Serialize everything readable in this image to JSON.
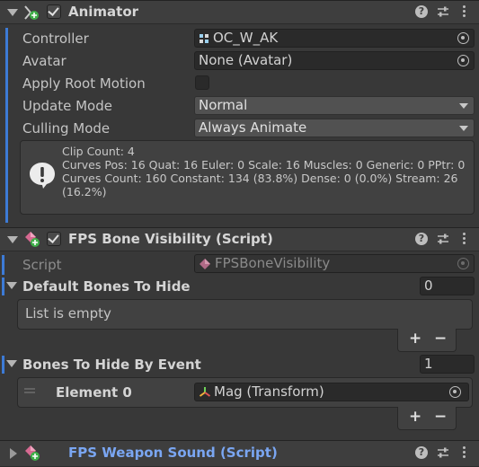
{
  "animator": {
    "title": "Animator",
    "enabled": true,
    "help": "?",
    "props": {
      "controller": {
        "label": "Controller",
        "value": "OC_W_AK"
      },
      "avatar": {
        "label": "Avatar",
        "value": "None (Avatar)"
      },
      "apply_root_motion": {
        "label": "Apply Root Motion",
        "checked": false
      },
      "update_mode": {
        "label": "Update Mode",
        "value": "Normal"
      },
      "culling_mode": {
        "label": "Culling Mode",
        "value": "Always Animate"
      }
    },
    "info": {
      "lines": [
        "Clip Count: 4",
        "Curves Pos: 16 Quat: 16 Euler: 0 Scale: 16 Muscles: 0 Generic: 0 PPtr: 0",
        "Curves Count: 160 Constant: 134 (83.8%) Dense: 0 (0.0%) Stream: 26",
        "(16.2%)"
      ]
    }
  },
  "fps_bone_visibility": {
    "title": "FPS Bone Visibility (Script)",
    "enabled": true,
    "help": "?",
    "script": {
      "label": "Script",
      "value": "FPSBoneVisibility"
    },
    "default_bones": {
      "label": "Default Bones To Hide",
      "size": "0",
      "empty_text": "List is empty"
    },
    "bones_by_event": {
      "label": "Bones To Hide By Event",
      "size": "1",
      "element": {
        "label": "Element 0",
        "value": "Mag (Transform)"
      }
    },
    "add": "+",
    "remove": "−"
  },
  "fps_weapon_sound": {
    "title": "FPS Weapon Sound (Script)",
    "help": "?"
  },
  "colors": {
    "background": "#383838",
    "header": "#3e3e3e",
    "field": "#2a2a2a",
    "accent_blue": "#3d7bd6",
    "link_title": "#7aa6f2"
  }
}
